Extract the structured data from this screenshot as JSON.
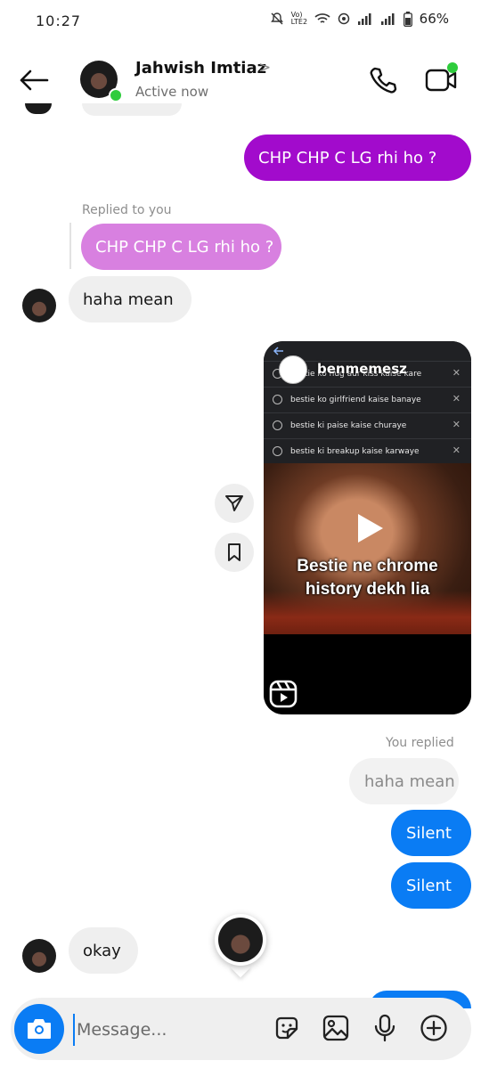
{
  "status_bar": {
    "time": "10:27",
    "network_label": "Vo) LTE2",
    "battery": "66%"
  },
  "header": {
    "contact_name": "Jahwish Imtiaz",
    "status": "Active now",
    "name_chevron": ">"
  },
  "messages": {
    "m1": {
      "text": "CHP CHP C LG rhi ho ?",
      "sender": "me",
      "color": "#a20bcc"
    },
    "reply_label": "Replied to you",
    "m2": {
      "text": "CHP CHP C LG rhi ho ?",
      "sender": "them",
      "color": "#d880e0"
    },
    "m3": {
      "text": "haha mean",
      "sender": "them"
    },
    "reel": {
      "username": "benmemesz",
      "search_rows": [
        "bestie ko hug aur kiss kaise kare",
        "bestie ko girlfriend kaise banaye",
        "bestie ki paise kaise churaye",
        "bestie ki breakup kaise karwaye"
      ],
      "caption_line1": "Bestie ne chrome",
      "caption_line2": "history dekh lia"
    },
    "you_replied_label": "You replied",
    "m4_quoted": {
      "text": "haha mean"
    },
    "m5": {
      "text": "Silent",
      "sender": "me",
      "color": "#0a7cf4"
    },
    "m6": {
      "text": "Silent",
      "sender": "me",
      "color": "#0a7cf4"
    },
    "m7": {
      "text": "okay",
      "sender": "them"
    }
  },
  "composer": {
    "placeholder": "Message..."
  },
  "icons": {
    "back": "arrow-left-icon",
    "call": "phone-icon",
    "video": "video-camera-icon",
    "share": "send-icon",
    "save": "bookmark-icon",
    "camera": "camera-icon",
    "sticker": "sticker-icon",
    "gallery": "image-icon",
    "mic": "microphone-icon",
    "more": "plus-circle-icon",
    "reel": "reels-icon",
    "play": "play-icon"
  }
}
